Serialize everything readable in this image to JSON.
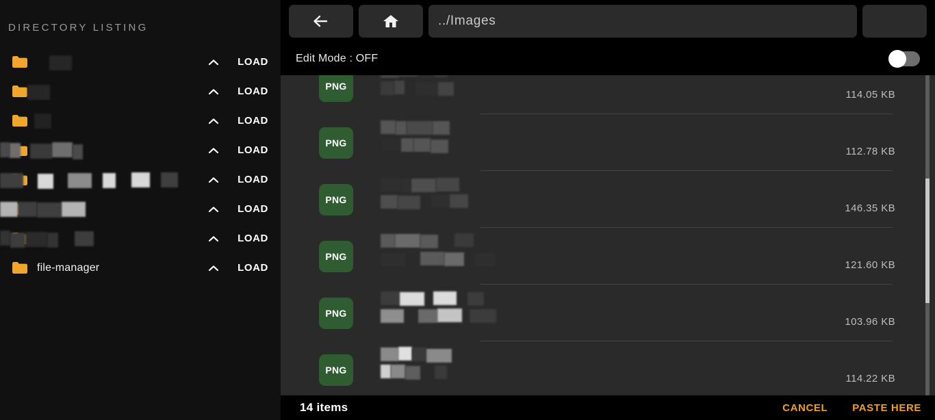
{
  "colors": {
    "sidebar_bg": "#111111",
    "main_bg": "#2a2a2a",
    "toolbar_bg": "#000000",
    "accent_orange": "#f0a01e",
    "folder_orange": "#f0a62a",
    "png_green": "#2f5c31",
    "divider": "#464646",
    "scroll_thumb": "#c8c8c8",
    "scroll_track": "#5a5a5a"
  },
  "sidebar": {
    "title": "DIRECTORY LISTING",
    "rows": [
      {
        "name": "",
        "redacted": true,
        "chevron": "chevron-up",
        "load_label": "LOAD"
      },
      {
        "name": "",
        "redacted": true,
        "chevron": "chevron-up",
        "load_label": "LOAD"
      },
      {
        "name": "",
        "redacted": true,
        "chevron": "chevron-up",
        "load_label": "LOAD"
      },
      {
        "name": "",
        "redacted": true,
        "chevron": "chevron-up",
        "load_label": "LOAD"
      },
      {
        "name": "",
        "redacted": true,
        "chevron": "chevron-up",
        "load_label": "LOAD"
      },
      {
        "name": "",
        "redacted": true,
        "chevron": "chevron-up",
        "load_label": "LOAD"
      },
      {
        "name": "",
        "redacted": true,
        "chevron": "chevron-up",
        "load_label": "LOAD"
      },
      {
        "name": "file-manager",
        "redacted": false,
        "chevron": "chevron-up",
        "load_label": "LOAD"
      }
    ]
  },
  "toolbar": {
    "back_icon": "arrow-left-icon",
    "home_icon": "home-icon",
    "path_value": "../Images",
    "path_placeholder": "../Images",
    "menu_icon": "kebab-menu-icon"
  },
  "edit_mode": {
    "label": "Edit Mode : OFF",
    "state": "OFF",
    "toggle_on": false
  },
  "file_list": {
    "badge_label": "PNG",
    "rows": [
      {
        "type": "PNG",
        "name": "",
        "redacted": true,
        "size": "114.05 KB"
      },
      {
        "type": "PNG",
        "name": "",
        "redacted": true,
        "size": "112.78 KB"
      },
      {
        "type": "PNG",
        "name": "",
        "redacted": true,
        "size": "146.35 KB"
      },
      {
        "type": "PNG",
        "name": "",
        "redacted": true,
        "size": "121.60 KB"
      },
      {
        "type": "PNG",
        "name": "",
        "redacted": true,
        "size": "103.96 KB"
      },
      {
        "type": "PNG",
        "name": "",
        "redacted": true,
        "size": "114.22 KB"
      }
    ]
  },
  "scrollbar": {
    "thumb_top_pct": 30,
    "thumb_height_pct": 36
  },
  "bottom_bar": {
    "item_count": "14 items",
    "cancel_label": "CANCEL",
    "paste_label": "PASTE HERE"
  }
}
